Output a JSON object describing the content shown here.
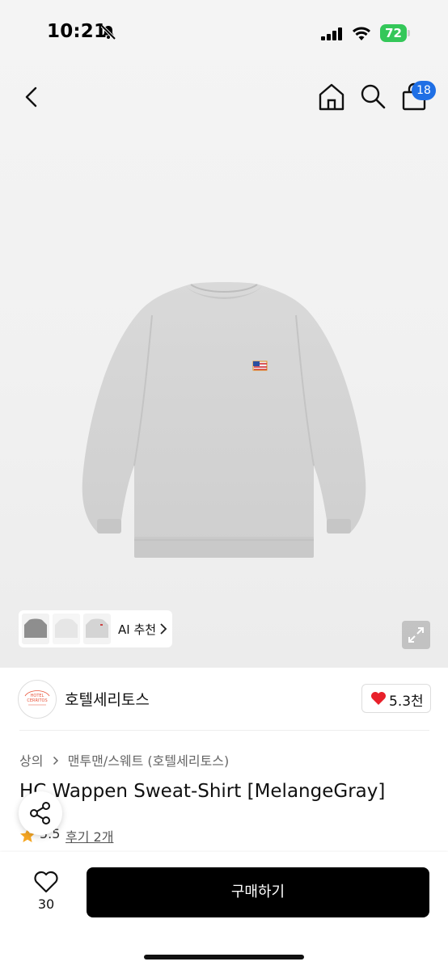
{
  "status_bar": {
    "time": "10:21",
    "battery": "72"
  },
  "nav": {
    "back_icon": "chevron-left-icon",
    "home_icon": "home-icon",
    "search_icon": "search-icon",
    "bag_icon": "shopping-bag-icon",
    "cart_count": "18"
  },
  "gallery": {
    "ai_label": "AI 추천",
    "thumbnail_colors": [
      "#8e8e8e",
      "#e6e6e6",
      "#d4d4d4"
    ]
  },
  "store": {
    "name": "호텔세리토스",
    "logo_text": "HOTEL CERRITOS",
    "like_count": "5.3천"
  },
  "breadcrumb": [
    "상의",
    "맨투맨/스웨트 (호텔세리토스)"
  ],
  "product": {
    "title": "HC Wappen Sweat-Shirt [MelangeGray]",
    "rating": "5.5",
    "review_link": "후기 2개"
  },
  "bottom_bar": {
    "wishlist_count": "30",
    "buy_label": "구매하기"
  },
  "colors": {
    "accent_blue": "#1f6fe5",
    "heart_red": "#e8202a",
    "star_orange": "#f5a623"
  }
}
